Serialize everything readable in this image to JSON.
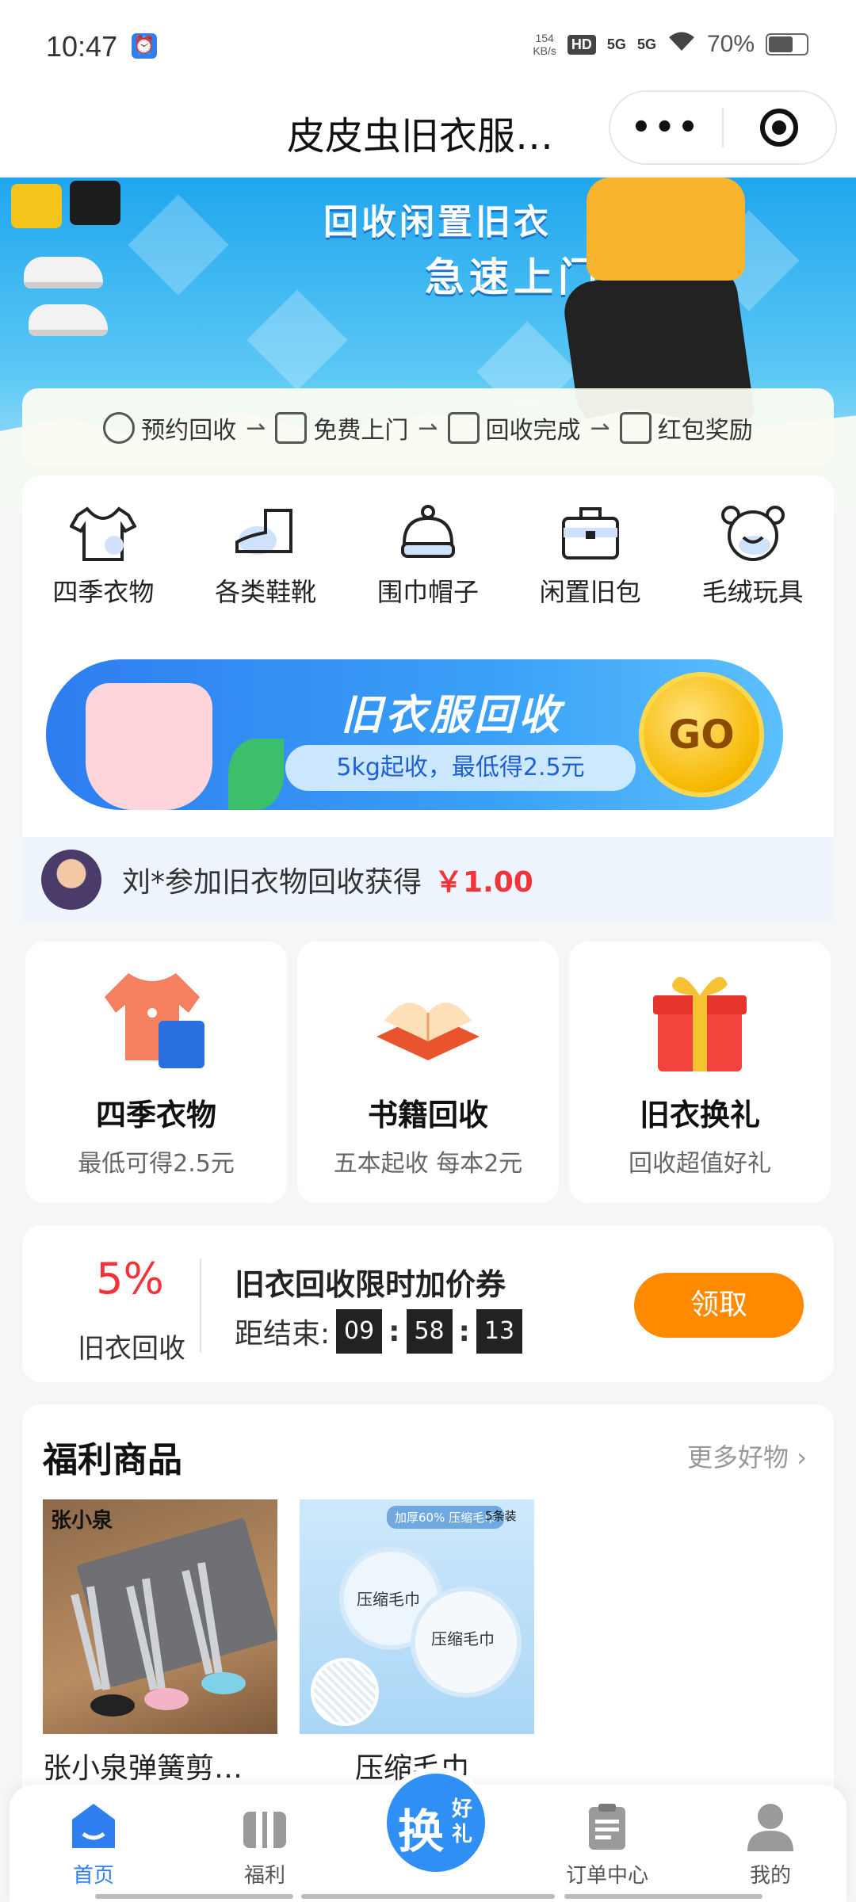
{
  "status_bar": {
    "time": "10:47",
    "speed_value": "154",
    "speed_unit": "KB/s",
    "hd_label": "HD",
    "signal1": "5G",
    "signal2": "5G",
    "battery": "70%"
  },
  "nav": {
    "title": "皮皮虫旧衣服…",
    "more_icon": "more-dots-icon",
    "close_icon": "target-icon"
  },
  "banner": {
    "line1": "回收闲置旧衣",
    "line2": "急速上门"
  },
  "steps": [
    {
      "label": "预约回收",
      "icon": "clock-icon"
    },
    {
      "label": "免费上门",
      "icon": "door-icon"
    },
    {
      "label": "回收完成",
      "icon": "recycle-icon"
    },
    {
      "label": "红包奖励",
      "icon": "red-envelope-icon"
    }
  ],
  "categories": [
    {
      "label": "四季衣物",
      "icon": "tshirt-icon"
    },
    {
      "label": "各类鞋靴",
      "icon": "boot-icon"
    },
    {
      "label": "围巾帽子",
      "icon": "hat-icon"
    },
    {
      "label": "闲置旧包",
      "icon": "bag-icon"
    },
    {
      "label": "毛绒玩具",
      "icon": "bear-icon"
    }
  ],
  "recycle_banner": {
    "title": "旧衣服回收",
    "subtitle": "5kg起收，最低得2.5元",
    "go": "GO"
  },
  "ticker": {
    "text": "刘*参加旧衣物回收获得",
    "amount": "￥1.00"
  },
  "features": [
    {
      "title": "四季衣物",
      "subtitle": "最低可得2.5元"
    },
    {
      "title": "书籍回收",
      "subtitle": "五本起收 每本2元"
    },
    {
      "title": "旧衣换礼",
      "subtitle": "回收超值好礼"
    }
  ],
  "coupon": {
    "percent": "5%",
    "percent_label": "旧衣回收",
    "title": "旧衣回收限时加价券",
    "countdown_label": "距结束:",
    "hh": "09",
    "mm": "58",
    "ss": "13",
    "colon": ":",
    "button": "领取"
  },
  "welfare": {
    "title": "福利商品",
    "more": "更多好物 ›",
    "products": [
      {
        "name": "张小泉弹簧剪…",
        "brand": "张小泉"
      },
      {
        "name": "压缩毛巾",
        "badge": "加厚60% 压缩毛巾",
        "count": "5条装",
        "label": "压缩毛巾"
      }
    ]
  },
  "tabbar": {
    "home": "首页",
    "welfare": "福利",
    "swap_big": "换",
    "swap_small1": "好",
    "swap_small2": "礼",
    "orders": "订单中心",
    "mine": "我的"
  },
  "colors": {
    "accent": "#2f7ff0",
    "price_red": "#f0343a",
    "button_orange": "#ff8a00"
  }
}
